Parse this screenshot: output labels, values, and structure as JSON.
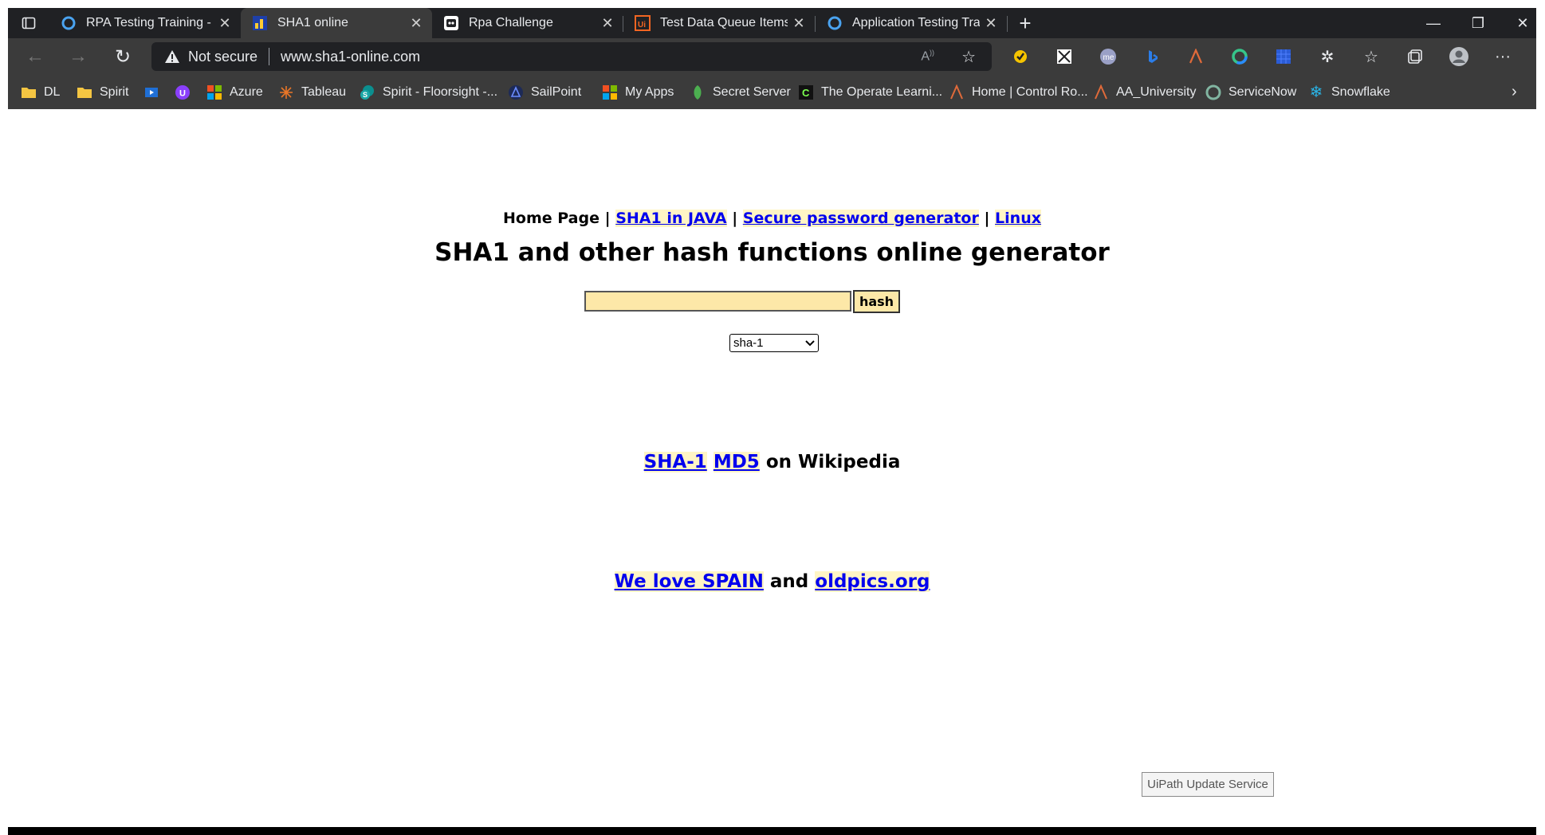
{
  "browser": {
    "tabs": [
      {
        "title": "RPA Testing Training - Additional",
        "icon": "circle-icon",
        "active": false
      },
      {
        "title": "SHA1 online",
        "icon": "sha1-site-icon",
        "active": true
      },
      {
        "title": "Rpa Challenge",
        "icon": "robot-icon",
        "active": false
      },
      {
        "title": "Test Data Queue Items - UiPath C",
        "icon": "uipath-icon",
        "active": false
      },
      {
        "title": "Application Testing Training - Ge",
        "icon": "circle-icon",
        "active": false
      }
    ],
    "address": {
      "security_label": "Not secure",
      "url": "www.sha1-online.com"
    },
    "bookmarks": [
      {
        "label": "DL",
        "icon": "folder-icon"
      },
      {
        "label": "Spirit",
        "icon": "folder-icon"
      },
      {
        "label": "",
        "icon": "video-icon"
      },
      {
        "label": "",
        "icon": "u-badge-icon"
      },
      {
        "label": "Azure",
        "icon": "microsoft-icon"
      },
      {
        "label": "Tableau",
        "icon": "tableau-icon"
      },
      {
        "label": "Spirit - Floorsight -...",
        "icon": "sharepoint-icon"
      },
      {
        "label": "SailPoint",
        "icon": "sailpoint-icon"
      },
      {
        "label": "My Apps",
        "icon": "microsoft-icon"
      },
      {
        "label": "Secret Server",
        "icon": "secret-server-icon"
      },
      {
        "label": "The Operate Learni...",
        "icon": "c-logo-icon"
      },
      {
        "label": "Home | Control Ro...",
        "icon": "a-logo-icon"
      },
      {
        "label": "AA_University",
        "icon": "a-logo-icon"
      },
      {
        "label": "ServiceNow",
        "icon": "servicenow-icon"
      },
      {
        "label": "Snowflake",
        "icon": "snowflake-icon"
      }
    ]
  },
  "page": {
    "nav": {
      "home": "Home Page",
      "sep": "|",
      "link_java": "SHA1 in JAVA",
      "link_password": "Secure password generator",
      "link_linux": "Linux"
    },
    "heading": "SHA1 and other hash functions online generator",
    "hash_input_value": "",
    "hash_button": "hash",
    "algorithm_selected": "sha-1",
    "wiki": {
      "link_sha1": "SHA-1",
      "link_md5": "MD5",
      "suffix": "on Wikipedia"
    },
    "promo": {
      "link_spain": "We love SPAIN",
      "conj": "and",
      "link_oldpics": "oldpics.org"
    },
    "uipath_button": "UiPath Update Service"
  },
  "colors": {
    "chrome_dark": "#202124",
    "chrome_toolbar": "#3b3b3b",
    "link": "#0000ee",
    "link_highlight": "#fff5c5",
    "input_bg": "#fde8a8"
  }
}
